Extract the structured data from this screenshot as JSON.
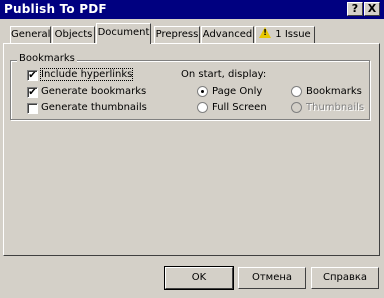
{
  "window": {
    "title": "Publish To PDF",
    "help_label": "?",
    "close_label": "X"
  },
  "tabs": [
    {
      "label": "General"
    },
    {
      "label": "Objects"
    },
    {
      "label": "Document",
      "active": true
    },
    {
      "label": "Prepress"
    },
    {
      "label": "Advanced"
    },
    {
      "label": "1 Issue",
      "icon": "warning-icon",
      "icon_glyph": "!"
    }
  ],
  "bookmarks_group": {
    "label": "Bookmarks",
    "options": [
      {
        "label": "Include hyperlinks",
        "checked": true
      },
      {
        "label": "Generate bookmarks",
        "checked": true
      },
      {
        "label": "Generate thumbnails",
        "checked": false
      }
    ]
  },
  "on_start": {
    "label": "On start, display:",
    "options": [
      {
        "label": "Page Only",
        "selected": true,
        "enabled": true
      },
      {
        "label": "Bookmarks",
        "selected": false,
        "enabled": true
      },
      {
        "label": "Full Screen",
        "selected": false,
        "enabled": true
      },
      {
        "label": "Thumbnails",
        "selected": false,
        "enabled": false
      }
    ]
  },
  "buttons": {
    "ok": "OK",
    "cancel": "Отмена",
    "help": "Справка"
  },
  "check_glyph": "✔"
}
